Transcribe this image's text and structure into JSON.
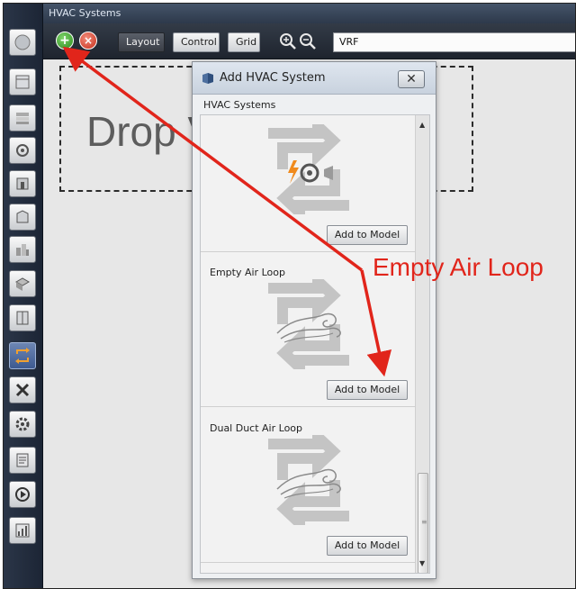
{
  "window": {
    "title": "HVAC Systems"
  },
  "toolbar": {
    "add_label": "+",
    "remove_label": "×",
    "layout": "Layout",
    "control": "Control",
    "grid": "Grid",
    "selected_system": "VRF"
  },
  "canvas": {
    "drop_text": "Drop V"
  },
  "sidebar": {
    "items": [
      "site-icon",
      "schedules-icon",
      "constructions-icon",
      "loads-icon",
      "space-types-icon",
      "geometry-icon",
      "facility-icon",
      "spaces-icon",
      "thermal-zones-icon",
      "hvac-systems-icon",
      "measures-icon",
      "simulation-settings-icon",
      "scripts-icon",
      "run-icon",
      "results-icon"
    ],
    "active_index": 9
  },
  "dialog": {
    "title": "Add HVAC System",
    "section": "HVAC Systems",
    "close_label": "✕",
    "items": [
      {
        "label": "",
        "button": "Add to Model",
        "graphic": "electric-fan-coil"
      },
      {
        "label": "Empty Air Loop",
        "button": "Add to Model",
        "graphic": "air-swirl"
      },
      {
        "label": "Dual Duct Air Loop",
        "button": "Add to Model",
        "graphic": "air-swirl"
      }
    ]
  },
  "annotation": {
    "text": "Empty Air Loop",
    "color": "#e1251b"
  }
}
